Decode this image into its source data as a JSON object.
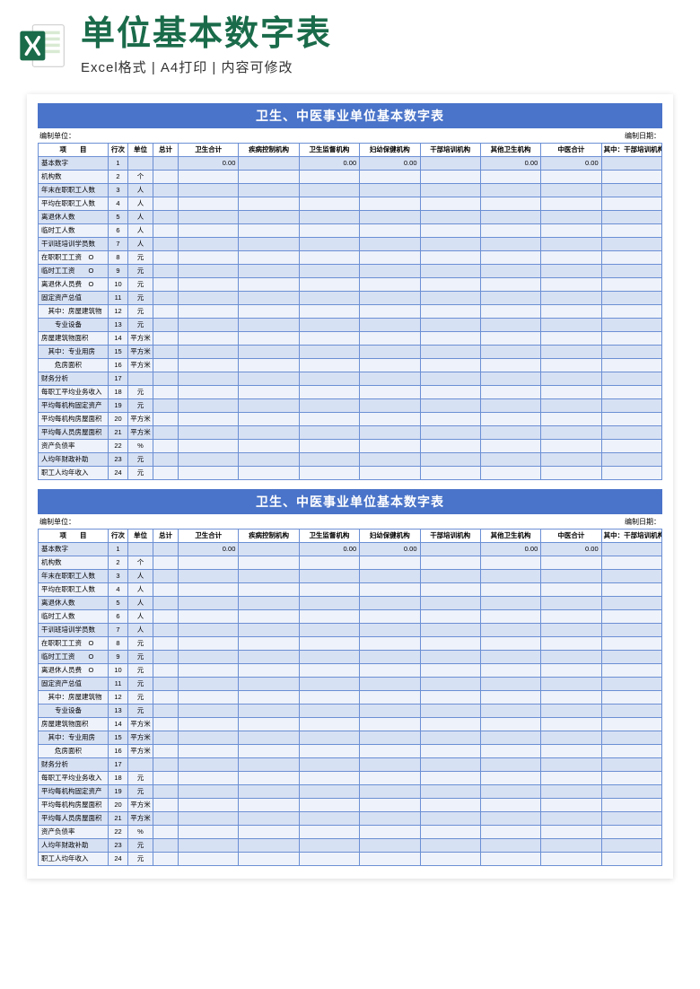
{
  "header": {
    "main_title": "单位基本数字表",
    "sub_title": "Excel格式 | A4打印 | 内容可修改",
    "icon_name": "excel-file-icon"
  },
  "sheet": {
    "title": "卫生、中医事业单位基本数字表",
    "meta_left": "编制单位：",
    "meta_right": "编制日期：",
    "columns": [
      "项　　目",
      "行次",
      "单位",
      "总计",
      "卫生合计",
      "疾病控制机构",
      "卫生监督机构",
      "妇幼保健机构",
      "干部培训机构",
      "其他卫生机构",
      "中医合计",
      "其中：干部培训机构"
    ],
    "rows": [
      {
        "label": "基本数字",
        "n": 1,
        "unit": "",
        "vals": [
          "",
          "0.00",
          "",
          "0.00",
          "0.00",
          "",
          "0.00",
          "0.00",
          ""
        ]
      },
      {
        "label": "机构数",
        "n": 2,
        "unit": "个",
        "vals": [
          "",
          "",
          "",
          "",
          "",
          "",
          "",
          "",
          ""
        ]
      },
      {
        "label": "年末在职职工人数",
        "n": 3,
        "unit": "人",
        "vals": [
          "",
          "",
          "",
          "",
          "",
          "",
          "",
          "",
          ""
        ]
      },
      {
        "label": "平均在职职工人数",
        "n": 4,
        "unit": "人",
        "vals": [
          "",
          "",
          "",
          "",
          "",
          "",
          "",
          "",
          ""
        ]
      },
      {
        "label": "离退休人数",
        "n": 5,
        "unit": "人",
        "vals": [
          "",
          "",
          "",
          "",
          "",
          "",
          "",
          "",
          ""
        ]
      },
      {
        "label": "临时工人数",
        "n": 6,
        "unit": "人",
        "vals": [
          "",
          "",
          "",
          "",
          "",
          "",
          "",
          "",
          ""
        ]
      },
      {
        "label": "干训班培训学员数",
        "n": 7,
        "unit": "人",
        "vals": [
          "",
          "",
          "",
          "",
          "",
          "",
          "",
          "",
          ""
        ]
      },
      {
        "label": "在职职工工资　O",
        "n": 8,
        "unit": "元",
        "vals": [
          "",
          "",
          "",
          "",
          "",
          "",
          "",
          "",
          ""
        ]
      },
      {
        "label": "临时工工资　　O",
        "n": 9,
        "unit": "元",
        "vals": [
          "",
          "",
          "",
          "",
          "",
          "",
          "",
          "",
          ""
        ]
      },
      {
        "label": "离退休人员费　O",
        "n": 10,
        "unit": "元",
        "vals": [
          "",
          "",
          "",
          "",
          "",
          "",
          "",
          "",
          ""
        ]
      },
      {
        "label": "固定资产总值",
        "n": 11,
        "unit": "元",
        "vals": [
          "",
          "",
          "",
          "",
          "",
          "",
          "",
          "",
          ""
        ]
      },
      {
        "label": "　其中：房屋建筑物",
        "n": 12,
        "unit": "元",
        "vals": [
          "",
          "",
          "",
          "",
          "",
          "",
          "",
          "",
          ""
        ]
      },
      {
        "label": "　　专业设备",
        "n": 13,
        "unit": "元",
        "vals": [
          "",
          "",
          "",
          "",
          "",
          "",
          "",
          "",
          ""
        ]
      },
      {
        "label": "房屋建筑物面积",
        "n": 14,
        "unit": "平方米",
        "vals": [
          "",
          "",
          "",
          "",
          "",
          "",
          "",
          "",
          ""
        ]
      },
      {
        "label": "　其中：专业用房",
        "n": 15,
        "unit": "平方米",
        "vals": [
          "",
          "",
          "",
          "",
          "",
          "",
          "",
          "",
          ""
        ]
      },
      {
        "label": "　　危房面积",
        "n": 16,
        "unit": "平方米",
        "vals": [
          "",
          "",
          "",
          "",
          "",
          "",
          "",
          "",
          ""
        ]
      },
      {
        "label": "财务分析",
        "n": 17,
        "unit": "",
        "vals": [
          "",
          "",
          "",
          "",
          "",
          "",
          "",
          "",
          ""
        ]
      },
      {
        "label": "每职工平均业务收入",
        "n": 18,
        "unit": "元",
        "vals": [
          "",
          "",
          "",
          "",
          "",
          "",
          "",
          "",
          ""
        ]
      },
      {
        "label": "平均每机构固定资产",
        "n": 19,
        "unit": "元",
        "vals": [
          "",
          "",
          "",
          "",
          "",
          "",
          "",
          "",
          ""
        ]
      },
      {
        "label": "平均每机构房屋面积",
        "n": 20,
        "unit": "平方米",
        "vals": [
          "",
          "",
          "",
          "",
          "",
          "",
          "",
          "",
          ""
        ]
      },
      {
        "label": "平均每人员房屋面积",
        "n": 21,
        "unit": "平方米",
        "vals": [
          "",
          "",
          "",
          "",
          "",
          "",
          "",
          "",
          ""
        ]
      },
      {
        "label": "资产负债率",
        "n": 22,
        "unit": "%",
        "vals": [
          "",
          "",
          "",
          "",
          "",
          "",
          "",
          "",
          ""
        ]
      },
      {
        "label": "人均年财政补助",
        "n": 23,
        "unit": "元",
        "vals": [
          "",
          "",
          "",
          "",
          "",
          "",
          "",
          "",
          ""
        ]
      },
      {
        "label": "职工人均年收入",
        "n": 24,
        "unit": "元",
        "vals": [
          "",
          "",
          "",
          "",
          "",
          "",
          "",
          "",
          ""
        ]
      }
    ]
  }
}
